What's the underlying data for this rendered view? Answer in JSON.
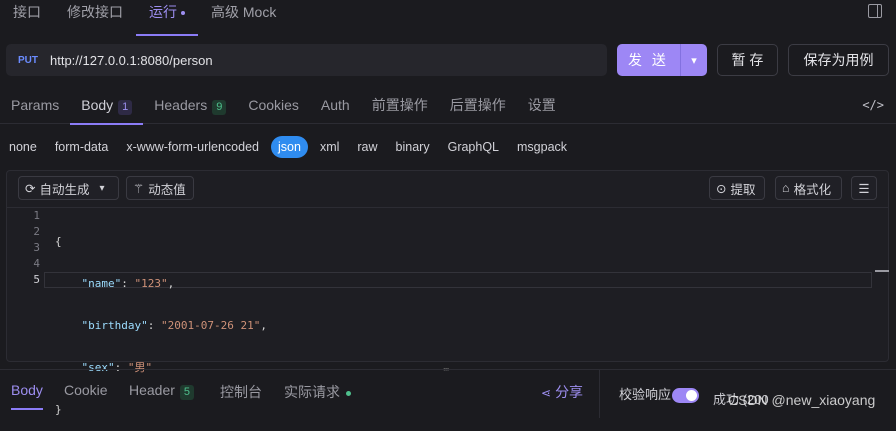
{
  "top_tabs": [
    {
      "label": "接口"
    },
    {
      "label": "修改接口"
    },
    {
      "label": "运行"
    },
    {
      "label": "高级 Mock"
    }
  ],
  "request": {
    "method": "PUT",
    "url": "http://127.0.0.1:8080/person",
    "send_label": "发 送",
    "save_draft_label": "暂 存",
    "save_case_label": "保存为用例"
  },
  "request_tabs": [
    {
      "label": "Params"
    },
    {
      "label": "Body",
      "badge": "1"
    },
    {
      "label": "Headers",
      "badge": "9"
    },
    {
      "label": "Cookies"
    },
    {
      "label": "Auth"
    },
    {
      "label": "前置操作"
    },
    {
      "label": "后置操作"
    },
    {
      "label": "设置"
    }
  ],
  "body_types": [
    "none",
    "form-data",
    "x-www-form-urlencoded",
    "json",
    "xml",
    "raw",
    "binary",
    "GraphQL",
    "msgpack"
  ],
  "body_type_selected": "json",
  "editor_toolbar": {
    "auto_generate": "自动生成",
    "dynamic_value": "动态值",
    "extract": "提取",
    "format": "格式化"
  },
  "editor": {
    "line_numbers": [
      "1",
      "2",
      "3",
      "4",
      "5"
    ],
    "lines": {
      "l1": "{",
      "l2_key": "\"name\"",
      "l2_val": "\"123\"",
      "l3_key": "\"birthday\"",
      "l3_val": "\"2001-07-26 21\"",
      "l4_key": "\"sex\"",
      "l4_val": "\"男\"",
      "l5": "}"
    }
  },
  "response_tabs": [
    {
      "label": "Body"
    },
    {
      "label": "Cookie"
    },
    {
      "label": "Header",
      "badge": "5"
    },
    {
      "label": "控制台"
    },
    {
      "label": "实际请求"
    }
  ],
  "share_label": "分享",
  "validate_label": "校验响应",
  "validate_on": true,
  "status_text": "成功 (200",
  "watermark": "CSDN @new_xiaoyang",
  "colors": {
    "accent": "#9d87f5",
    "method": "#6b8cff",
    "json_pill": "#2f8cf0",
    "badge_green": "#4fc08d"
  }
}
